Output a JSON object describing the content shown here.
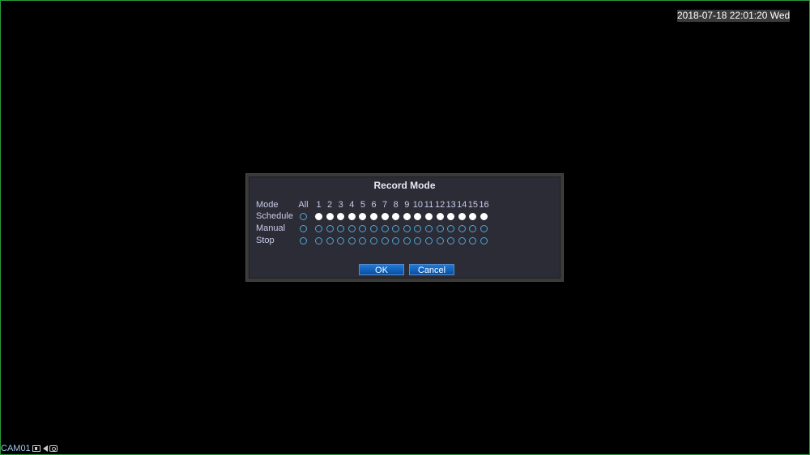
{
  "overlay": {
    "datetime": "2018-07-18 22:01:20 Wed",
    "camera_name": "CAM01"
  },
  "dialog": {
    "title": "Record Mode",
    "mode_label": "Mode",
    "all_label": "All",
    "channels": [
      "1",
      "2",
      "3",
      "4",
      "5",
      "6",
      "7",
      "8",
      "9",
      "10",
      "11",
      "12",
      "13",
      "14",
      "15",
      "16"
    ],
    "rows": [
      {
        "label": "Schedule",
        "all": false,
        "selected": [
          true,
          true,
          true,
          true,
          true,
          true,
          true,
          true,
          true,
          true,
          true,
          true,
          true,
          true,
          true,
          true
        ]
      },
      {
        "label": "Manual",
        "all": false,
        "selected": [
          false,
          false,
          false,
          false,
          false,
          false,
          false,
          false,
          false,
          false,
          false,
          false,
          false,
          false,
          false,
          false
        ]
      },
      {
        "label": "Stop",
        "all": false,
        "selected": [
          false,
          false,
          false,
          false,
          false,
          false,
          false,
          false,
          false,
          false,
          false,
          false,
          false,
          false,
          false,
          false
        ]
      }
    ],
    "ok_label": "OK",
    "cancel_label": "Cancel"
  },
  "colors": {
    "radio_ring": "#4fa6d8",
    "radio_selected": "#ffffff",
    "button_blue": "#0a5fc0",
    "frame_border": "#2a9a3a"
  }
}
